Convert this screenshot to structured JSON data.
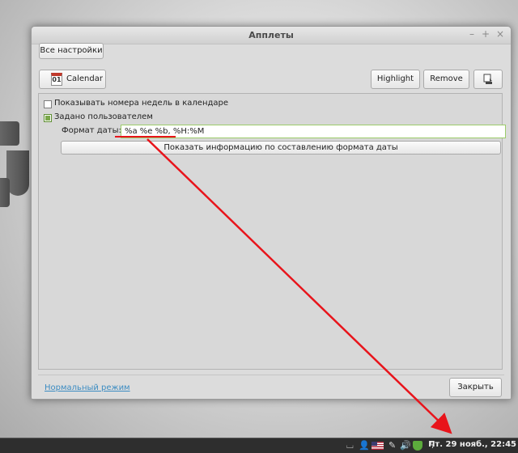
{
  "window": {
    "title": "Апплеты",
    "controls": [
      "–",
      "+",
      "×"
    ]
  },
  "toolbar": {
    "all_settings_label": "Все настройки",
    "applet_name": "Calendar",
    "calendar_icon_day": "01",
    "highlight_label": "Highlight",
    "remove_label": "Remove",
    "config_icon": "applet-config-icon"
  },
  "settings": {
    "show_week_numbers_label": "Показывать номера недель в календаре",
    "show_week_numbers_checked": false,
    "custom_format_label": "Задано пользователем",
    "custom_format_checked": true,
    "date_format_label": "Формат даты:",
    "date_format_value": "%a %e %b, %H:%M",
    "format_info_button": "Показать информацию по составлению формата даты"
  },
  "footer": {
    "normal_mode_link": "Нормальный режим",
    "close_label": "Закрыть"
  },
  "taskbar": {
    "clock": "Пт. 29 нояб., 22:45",
    "tray_icons": [
      "keyboard-icon",
      "user-icon",
      "us-flag-icon",
      "pen-icon",
      "volume-icon",
      "shield-icon",
      "network-icon"
    ]
  },
  "annotation": {
    "color": "#e8141b"
  }
}
